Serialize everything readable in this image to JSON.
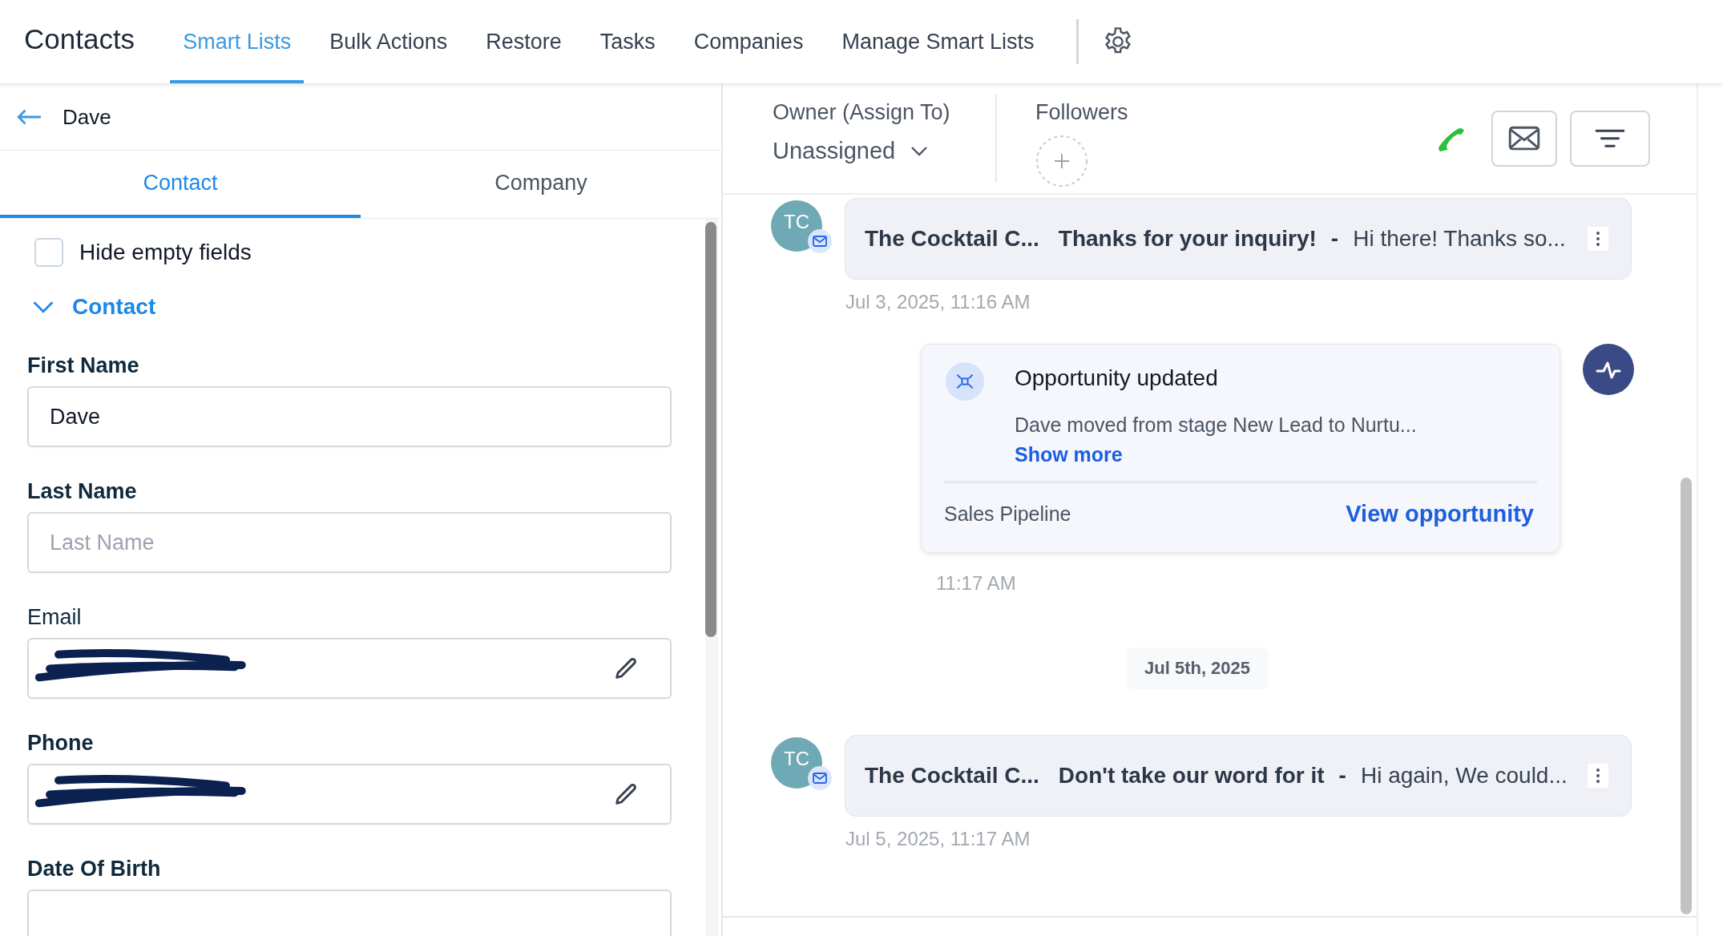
{
  "header": {
    "title": "Contacts",
    "tabs": [
      {
        "label": "Smart Lists",
        "selected": true
      },
      {
        "label": "Bulk Actions",
        "selected": false
      },
      {
        "label": "Restore",
        "selected": false
      },
      {
        "label": "Tasks",
        "selected": false
      },
      {
        "label": "Companies",
        "selected": false
      },
      {
        "label": "Manage Smart Lists",
        "selected": false
      }
    ]
  },
  "contact_panel": {
    "back_label": "Dave",
    "tabs": [
      {
        "label": "Contact",
        "selected": true
      },
      {
        "label": "Company",
        "selected": false
      }
    ],
    "hide_empty_fields": {
      "label": "Hide empty fields",
      "checked": false
    },
    "section": {
      "title": "Contact",
      "expanded": true
    },
    "fields": [
      {
        "label": "First Name",
        "kind": "text",
        "value": "Dave",
        "editable": false
      },
      {
        "label": "Last Name",
        "kind": "text",
        "placeholder": "Last Name",
        "editable": false
      },
      {
        "label": "Email",
        "kind": "redacted",
        "editable": true
      },
      {
        "label": "Phone",
        "kind": "redacted",
        "editable": true
      },
      {
        "label": "Date Of Birth",
        "kind": "text",
        "editable": false
      }
    ]
  },
  "activity_panel": {
    "owner": {
      "label": "Owner (Assign To)",
      "value": "Unassigned"
    },
    "followers": {
      "label": "Followers"
    },
    "timeline": [
      {
        "kind": "email",
        "initials": "TC",
        "sender": "The Cocktail C...",
        "subject": "Thanks for your inquiry!",
        "separator": "-",
        "preview": "Hi there! Thanks so...",
        "time": "Jul 3, 2025, 11:16 AM"
      },
      {
        "kind": "opportunity",
        "title": "Opportunity updated",
        "text": "Dave moved from stage New Lead to Nurtu...",
        "more": "Show more",
        "pipeline": "Sales Pipeline",
        "link": "View opportunity",
        "time": "11:17 AM"
      },
      {
        "kind": "date",
        "label": "Jul 5th, 2025"
      },
      {
        "kind": "email",
        "initials": "TC",
        "sender": "The Cocktail C...",
        "subject": "Don't take our word for it",
        "separator": "-",
        "preview": "Hi again, We could...",
        "time": "Jul 5, 2025, 11:17 AM"
      }
    ]
  }
}
